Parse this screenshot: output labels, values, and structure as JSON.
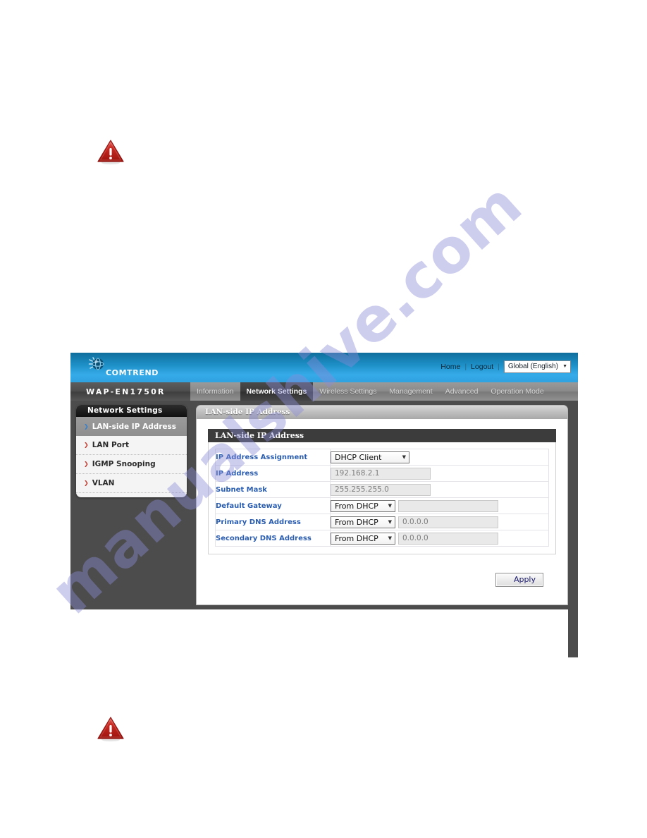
{
  "page": {
    "watermark_text": "manualshive.com",
    "alerts": [
      {
        "name": "warning-icon-top",
        "glyph": "warning-triangle-icon"
      },
      {
        "name": "warning-icon-bottom",
        "glyph": "warning-triangle-icon"
      }
    ]
  },
  "brand": {
    "logo_icon": "comtrend-globe-icon",
    "logo_text": "COMTREND",
    "model": "WAP-EN1750R"
  },
  "header": {
    "home_label": "Home",
    "separator": "|",
    "logout_label": "Logout",
    "language_value": "Global (English)",
    "caret": "▼"
  },
  "nav": {
    "tabs": [
      {
        "label": "Information",
        "active": false
      },
      {
        "label": "Network Settings",
        "active": true
      },
      {
        "label": "Wireless Settings",
        "active": false
      },
      {
        "label": "Management",
        "active": false
      },
      {
        "label": "Advanced",
        "active": false
      },
      {
        "label": "Operation Mode",
        "active": false
      }
    ]
  },
  "sidebar": {
    "title": "Network Settings",
    "items": [
      {
        "label": "LAN-side IP Address",
        "selected": true
      },
      {
        "label": "LAN Port",
        "selected": false
      },
      {
        "label": "IGMP Snooping",
        "selected": false
      },
      {
        "label": "VLAN",
        "selected": false
      }
    ],
    "arrow_glyph": "❯"
  },
  "content": {
    "card_title": "LAN-side IP Address",
    "section_title": "LAN-side IP Address",
    "rows": [
      {
        "label": "IP Address Assignment",
        "control": "select",
        "select_value": "DHCP Client",
        "text_value": null
      },
      {
        "label": "IP Address",
        "control": "text",
        "select_value": null,
        "text_value": "192.168.2.1"
      },
      {
        "label": "Subnet Mask",
        "control": "text",
        "select_value": null,
        "text_value": "255.255.255.0"
      },
      {
        "label": "Default Gateway",
        "control": "select+text",
        "select_value": "From DHCP",
        "text_value": ""
      },
      {
        "label": "Primary DNS Address",
        "control": "select+text",
        "select_value": "From DHCP",
        "text_value": "0.0.0.0"
      },
      {
        "label": "Secondary DNS Address",
        "control": "select+text",
        "select_value": "From DHCP",
        "text_value": "0.0.0.0"
      }
    ],
    "apply_label": "Apply",
    "caret": "▼"
  },
  "colors": {
    "brand_blue_top": "#0f6e9c",
    "brand_blue_bottom": "#36abe9",
    "nav_gray": "#8b8b8b",
    "panel_dark": "#4c4c4c",
    "label_blue": "#2a5db0",
    "alert_red": "#c0201c",
    "watermark_violet": "#8a8ad8"
  }
}
